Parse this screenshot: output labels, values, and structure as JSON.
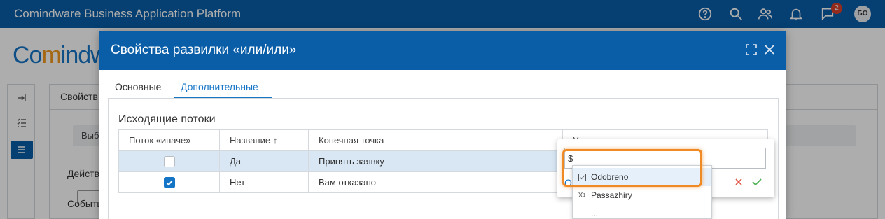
{
  "app": {
    "title": "Comindware Business Application Platform",
    "notification_count": "2",
    "user_initials": "БО",
    "brand_color": "#0a5ea8",
    "accent_color": "#f08a24"
  },
  "logo": {
    "part1": "Co",
    "part2": "m",
    "part3": "indw"
  },
  "background": {
    "tab_title": "Свойств",
    "select_text": "Выб",
    "label_action": "Действ",
    "label_events": "События"
  },
  "modal": {
    "title": "Свойства развилки «или/или»",
    "tabs": [
      {
        "label": "Основные",
        "active": false
      },
      {
        "label": "Дополнительные",
        "active": true
      }
    ],
    "section_title": "Исходящие потоки",
    "table": {
      "columns": [
        "Поток «иначе»",
        "Название ↑",
        "Конечная точка",
        "Условие"
      ],
      "rows": [
        {
          "else_flow": false,
          "name": "Да",
          "endpoint": "Принять заявку",
          "selected": true
        },
        {
          "else_flow": true,
          "name": "Нет",
          "endpoint": "Вам отказано",
          "selected": false
        }
      ]
    }
  },
  "editor": {
    "expression_value": "$",
    "link_text": "О",
    "suggestions": [
      {
        "icon": "checkbox-icon",
        "label": "Odobreno",
        "highlighted": true
      },
      {
        "icon": "x1-icon",
        "label": "Passazhiry",
        "highlighted": false
      },
      {
        "icon": "text-icon",
        "label": "...",
        "highlighted": false
      }
    ]
  }
}
